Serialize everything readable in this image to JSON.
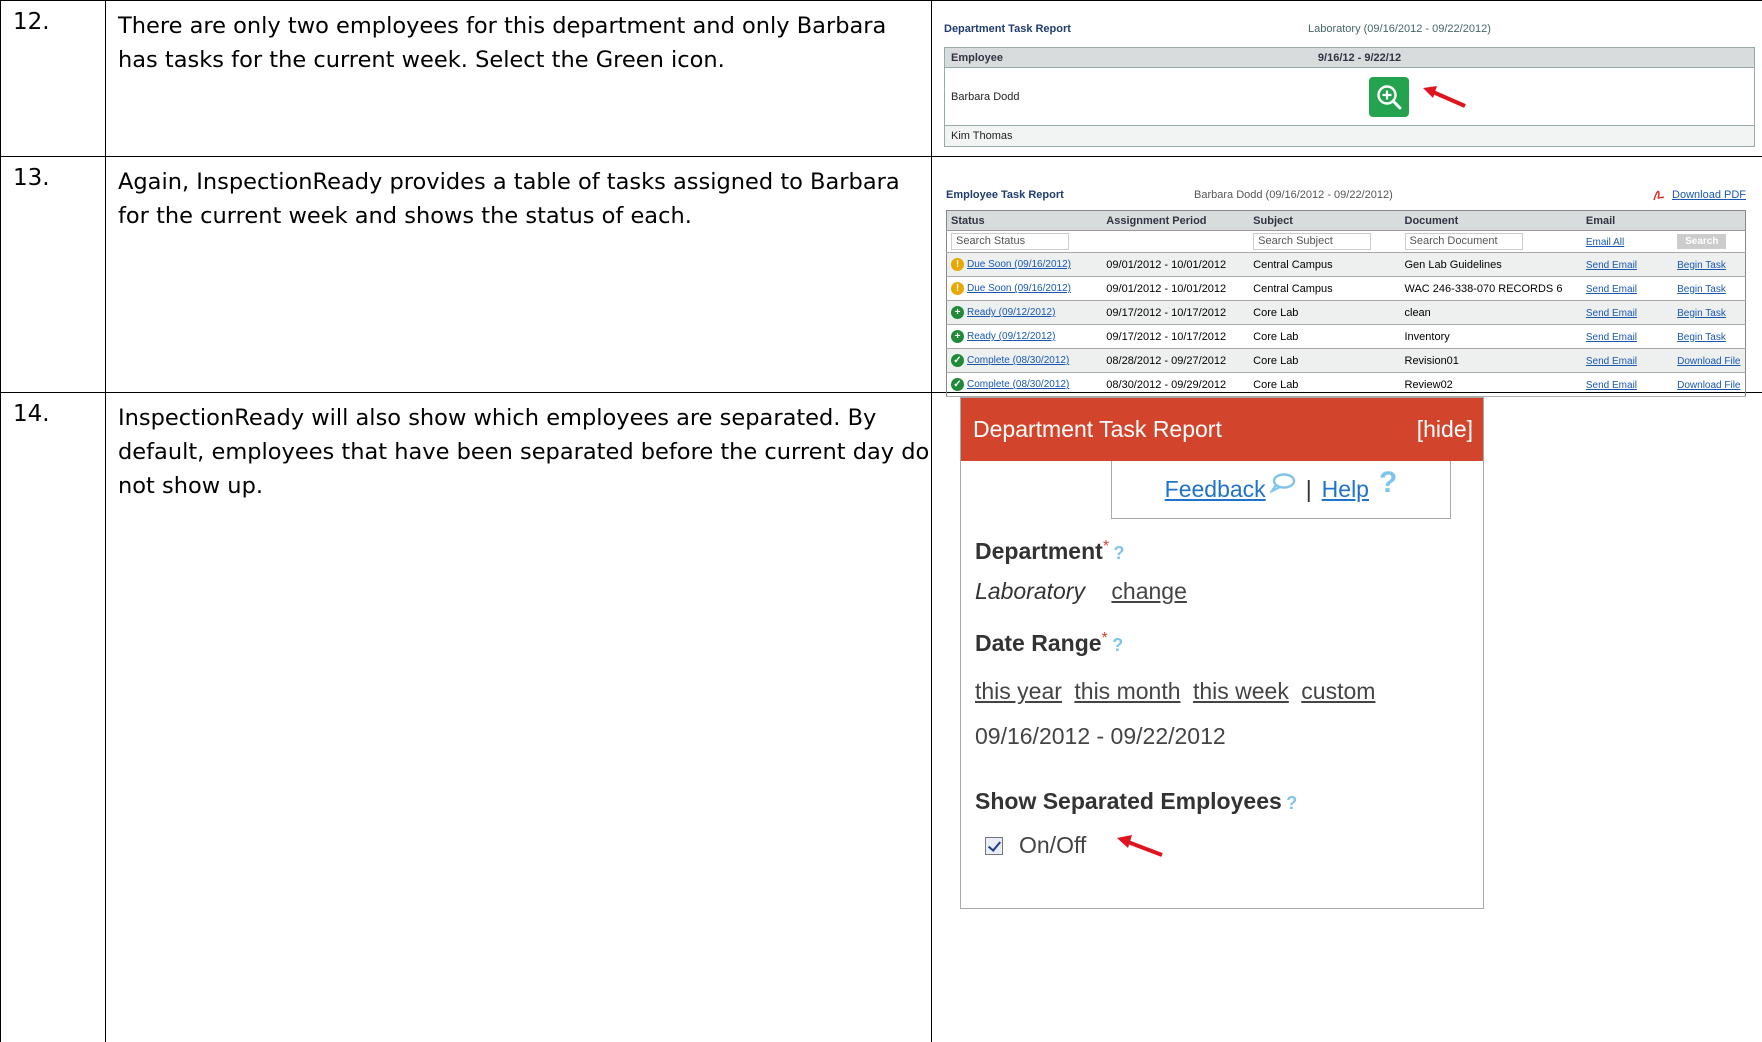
{
  "steps": [
    {
      "number": "12.",
      "text": "There are only two employees for this department and only Barbara has tasks for the current week.  Select the Green icon."
    },
    {
      "number": "13.",
      "text": "Again, InspectionReady provides a table of tasks assigned to Barbara for the current week and shows the status of each."
    },
    {
      "number": "14.",
      "text": "InspectionReady will also show which employees are separated.  By default, employees that have been separated before the current day do not show up."
    }
  ],
  "shot1": {
    "title": "Department Task Report",
    "range": "Laboratory (09/16/2012 - 09/22/2012)",
    "col_employee": "Employee",
    "col_week": "9/16/12 - 9/22/12",
    "employees": [
      "Barbara Dodd",
      "Kim Thomas"
    ],
    "accent": "#24a34f"
  },
  "shot2": {
    "title": "Employee Task Report",
    "subtitle": "Barbara Dodd (09/16/2012 - 09/22/2012)",
    "download_pdf": "Download PDF",
    "columns": [
      "Status",
      "Assignment Period",
      "Subject",
      "Document",
      "Email",
      ""
    ],
    "search": {
      "status": "Search Status",
      "subject": "Search Subject",
      "document": "Search Document",
      "email_all": "Email All",
      "button": "Search"
    },
    "rows": [
      {
        "icon": "warning-icon",
        "status": "Due Soon (09/16/2012)",
        "period": "09/01/2012 - 10/01/2012",
        "subject": "Central Campus",
        "document": "Gen Lab Guidelines",
        "email": "Send Email",
        "action": "Begin Task"
      },
      {
        "icon": "warning-icon",
        "status": "Due Soon (09/16/2012)",
        "period": "09/01/2012 - 10/01/2012",
        "subject": "Central Campus",
        "document": "WAC 246-338-070 RECORDS 6",
        "email": "Send Email",
        "action": "Begin Task"
      },
      {
        "icon": "plus-circle-icon",
        "status": "Ready (09/12/2012)",
        "period": "09/17/2012 - 10/17/2012",
        "subject": "Core Lab",
        "document": "clean",
        "email": "Send Email",
        "action": "Begin Task"
      },
      {
        "icon": "plus-circle-icon",
        "status": "Ready (09/12/2012)",
        "period": "09/17/2012 - 10/17/2012",
        "subject": "Core Lab",
        "document": "Inventory",
        "email": "Send Email",
        "action": "Begin Task"
      },
      {
        "icon": "check-circle-icon",
        "status": "Complete (08/30/2012)",
        "period": "08/28/2012 - 09/27/2012",
        "subject": "Core Lab",
        "document": "Revision01",
        "email": "Send Email",
        "action": "Download File"
      },
      {
        "icon": "check-circle-icon",
        "status": "Complete (08/30/2012)",
        "period": "08/30/2012 - 09/29/2012",
        "subject": "Core Lab",
        "document": "Review02",
        "email": "Send Email",
        "action": "Download File"
      }
    ]
  },
  "shot3": {
    "title": "Department Task Report",
    "hide": "[hide]",
    "feedback": "Feedback",
    "separator": "|",
    "help": "Help",
    "department_label": "Department",
    "department_value": "Laboratory",
    "change": "change",
    "date_range_label": "Date Range",
    "date_links": [
      "this year",
      "this month",
      "this week",
      "custom"
    ],
    "date_value": "09/16/2012 - 09/22/2012",
    "separated_label": "Show Separated Employees",
    "toggle_label": "On/Off",
    "header_color": "#d2452c"
  }
}
